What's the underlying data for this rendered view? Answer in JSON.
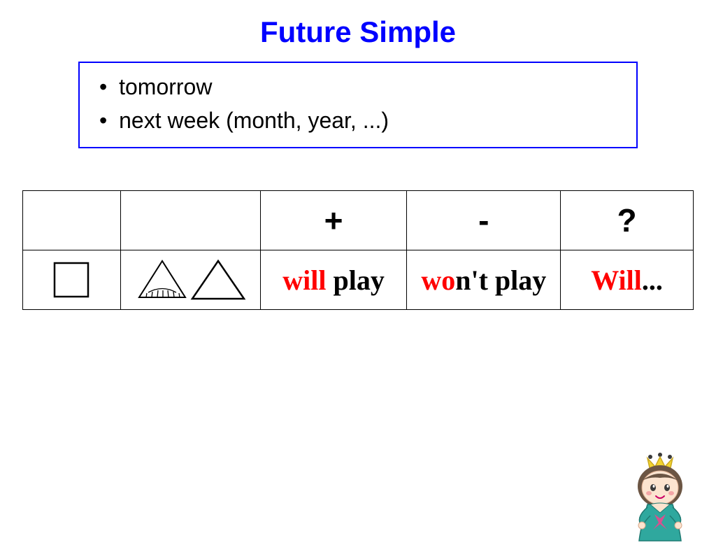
{
  "title": "Future Simple",
  "bullets": {
    "item0": "tomorrow",
    "item1": "next week (month, year, ...)"
  },
  "table": {
    "headers": {
      "plus": "+",
      "minus": "-",
      "question": "?"
    },
    "row": {
      "plus_red": "will",
      "plus_black": " play",
      "minus_red": "wo",
      "minus_black": "n't play",
      "q_red": "Will",
      "q_black": "..."
    }
  }
}
